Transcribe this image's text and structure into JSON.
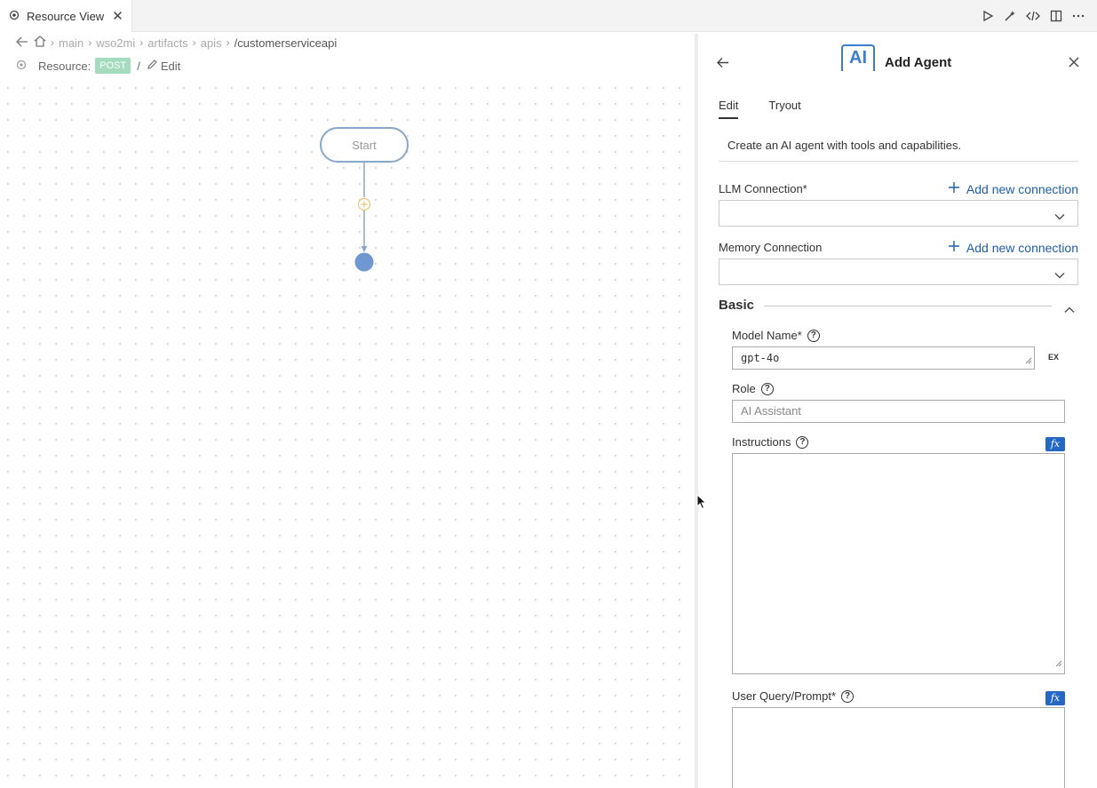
{
  "tab": {
    "title": "Resource View"
  },
  "breadcrumb": {
    "items": [
      "main",
      "wso2mi",
      "artifacts",
      "apis"
    ],
    "current": "/customerserviceapi"
  },
  "resource": {
    "label": "Resource:",
    "method": "POST",
    "slash": "/",
    "edit_label": "Edit"
  },
  "diagram": {
    "start_label": "Start"
  },
  "panel": {
    "title": "Add Agent",
    "logo_text": "AI",
    "tabs": [
      "Edit",
      "Tryout"
    ],
    "description": "Create an AI agent with tools and capabilities.",
    "llm_connection": {
      "label": "LLM Connection*",
      "add_label": "Add new connection"
    },
    "memory_connection": {
      "label": "Memory Connection",
      "add_label": "Add new connection"
    },
    "basic": {
      "heading": "Basic"
    },
    "model_name": {
      "label": "Model Name*",
      "value": "gpt-4o",
      "ex_label": "EX"
    },
    "role": {
      "label": "Role",
      "placeholder": "AI Assistant"
    },
    "instructions": {
      "label": "Instructions",
      "fx_label": "fx"
    },
    "user_query": {
      "label": "User Query/Prompt*",
      "fx_label": "fx"
    }
  }
}
